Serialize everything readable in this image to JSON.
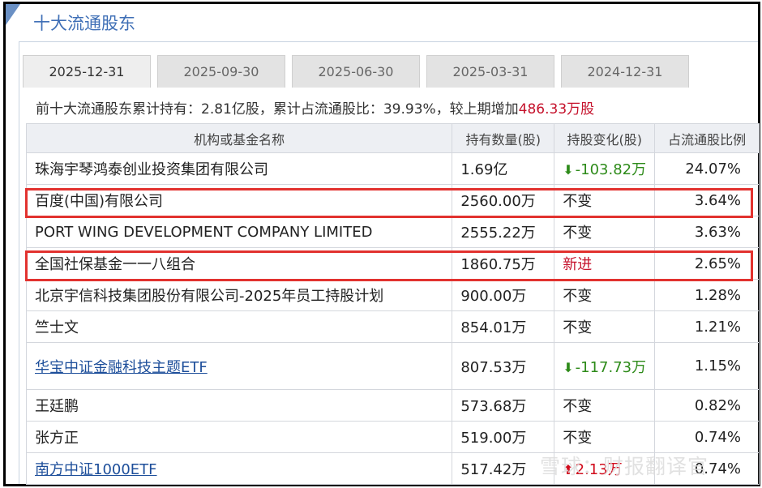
{
  "panel": {
    "title": "十大流通股东"
  },
  "tabs": [
    {
      "label": "2025-12-31",
      "active": true
    },
    {
      "label": "2025-09-30",
      "active": false
    },
    {
      "label": "2025-06-30",
      "active": false
    },
    {
      "label": "2025-03-31",
      "active": false
    },
    {
      "label": "2024-12-31",
      "active": false
    }
  ],
  "summary": {
    "prefix": "前十大流通股东累计持有：2.81亿股，累计占流通股比：39.93%，较上期增加",
    "highlight": "486.33万股"
  },
  "table": {
    "headers": [
      "机构或基金名称",
      "持有数量(股)",
      "持股变化(股)",
      "占流通股比例"
    ],
    "rows": [
      {
        "name": "珠海宇琴鸿泰创业投资集团有限公司",
        "qty": "1.69亿",
        "change": "-103.82万",
        "change_type": "down",
        "pct": "24.07%",
        "link": false
      },
      {
        "name": "百度(中国)有限公司",
        "qty": "2560.00万",
        "change": "不变",
        "change_type": "none",
        "pct": "3.64%",
        "link": false
      },
      {
        "name": "PORT WING DEVELOPMENT COMPANY LIMITED",
        "qty": "2555.22万",
        "change": "不变",
        "change_type": "none",
        "pct": "3.63%",
        "link": false
      },
      {
        "name": "全国社保基金一一八组合",
        "qty": "1860.75万",
        "change": "新进",
        "change_type": "new",
        "pct": "2.65%",
        "link": false
      },
      {
        "name": "北京宇信科技集团股份有限公司-2025年员工持股计划",
        "qty": "900.00万",
        "change": "不变",
        "change_type": "none",
        "pct": "1.28%",
        "link": false
      },
      {
        "name": "竺士文",
        "qty": "854.01万",
        "change": "不变",
        "change_type": "none",
        "pct": "1.21%",
        "link": false
      },
      {
        "name": "华宝中证金融科技主题ETF",
        "qty": "807.53万",
        "change": "-117.73万",
        "change_type": "down",
        "pct": "1.15%",
        "link": true
      },
      {
        "name": "王廷鹏",
        "qty": "573.68万",
        "change": "不变",
        "change_type": "none",
        "pct": "0.82%",
        "link": false
      },
      {
        "name": "张方正",
        "qty": "519.00万",
        "change": "不变",
        "change_type": "none",
        "pct": "0.74%",
        "link": false
      },
      {
        "name": "南方中证1000ETF",
        "qty": "517.42万",
        "change": "2.13万",
        "change_type": "up",
        "pct": "0.74%",
        "link": true
      }
    ]
  },
  "watermark": "雪球：财报翻译官",
  "colors": {
    "accent": "#3f6fb6",
    "highlight_red": "#e2322f",
    "decrease_green": "#2e8b1a",
    "increase_red": "#d10b1c"
  }
}
